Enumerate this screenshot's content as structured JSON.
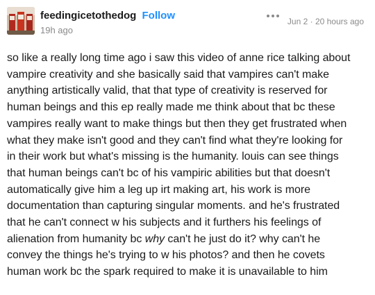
{
  "post": {
    "author": {
      "username": "feedingicetothedog",
      "follow_label": "Follow",
      "relative_time": "19h ago",
      "avatar_icon": "avatar-photo-icon"
    },
    "more_icon": "more-dots-icon",
    "date_text": "Jun 2 · 20 hours ago",
    "body": {
      "lines": [
        "so like a really long time ago i saw this video of anne rice talking about",
        "vampire creativity and she basically said that vampires can't make",
        "anything artistically valid, that that type of creativity is reserved for",
        "human beings and this ep really made me think about that bc these",
        "vampires really want to make things but then they get frustrated when",
        "what they make isn't good and they can't find what they're looking for",
        "in their work but what's missing is the humanity. louis can see things",
        "that human beings can't bc of his vampiric abilities but that doesn't",
        "automatically give him a leg up irt making art, his work is more",
        "documentation than capturing singular moments. and he's frustrated",
        "that he can't connect w his subjects and it furthers his feelings of"
      ],
      "line12_before": "alienation from humanity bc ",
      "line12_emphasis": "why",
      "line12_after": " can't he just do it? why can't he",
      "lines_end": [
        "convey the things he's trying to w his photos? and then he covets",
        "human work bc the spark required to make it is unavailable to him"
      ]
    },
    "colors": {
      "link_blue": "#1e90ff",
      "muted_gray": "#8a8a8a",
      "text": "#1a1a1a"
    }
  }
}
